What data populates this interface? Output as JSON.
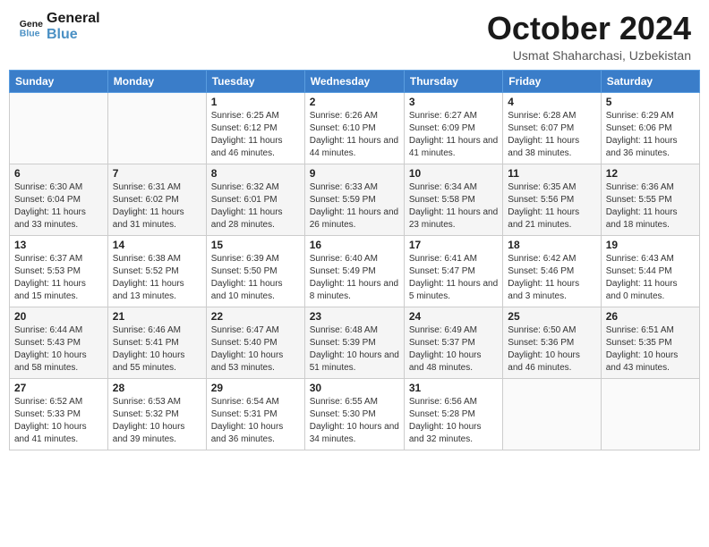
{
  "header": {
    "logo_line1": "General",
    "logo_line2": "Blue",
    "month_title": "October 2024",
    "subtitle": "Usmat Shaharchasi, Uzbekistan"
  },
  "days_of_week": [
    "Sunday",
    "Monday",
    "Tuesday",
    "Wednesday",
    "Thursday",
    "Friday",
    "Saturday"
  ],
  "weeks": [
    [
      {
        "day": "",
        "sunrise": "",
        "sunset": "",
        "daylight": ""
      },
      {
        "day": "",
        "sunrise": "",
        "sunset": "",
        "daylight": ""
      },
      {
        "day": "1",
        "sunrise": "Sunrise: 6:25 AM",
        "sunset": "Sunset: 6:12 PM",
        "daylight": "Daylight: 11 hours and 46 minutes."
      },
      {
        "day": "2",
        "sunrise": "Sunrise: 6:26 AM",
        "sunset": "Sunset: 6:10 PM",
        "daylight": "Daylight: 11 hours and 44 minutes."
      },
      {
        "day": "3",
        "sunrise": "Sunrise: 6:27 AM",
        "sunset": "Sunset: 6:09 PM",
        "daylight": "Daylight: 11 hours and 41 minutes."
      },
      {
        "day": "4",
        "sunrise": "Sunrise: 6:28 AM",
        "sunset": "Sunset: 6:07 PM",
        "daylight": "Daylight: 11 hours and 38 minutes."
      },
      {
        "day": "5",
        "sunrise": "Sunrise: 6:29 AM",
        "sunset": "Sunset: 6:06 PM",
        "daylight": "Daylight: 11 hours and 36 minutes."
      }
    ],
    [
      {
        "day": "6",
        "sunrise": "Sunrise: 6:30 AM",
        "sunset": "Sunset: 6:04 PM",
        "daylight": "Daylight: 11 hours and 33 minutes."
      },
      {
        "day": "7",
        "sunrise": "Sunrise: 6:31 AM",
        "sunset": "Sunset: 6:02 PM",
        "daylight": "Daylight: 11 hours and 31 minutes."
      },
      {
        "day": "8",
        "sunrise": "Sunrise: 6:32 AM",
        "sunset": "Sunset: 6:01 PM",
        "daylight": "Daylight: 11 hours and 28 minutes."
      },
      {
        "day": "9",
        "sunrise": "Sunrise: 6:33 AM",
        "sunset": "Sunset: 5:59 PM",
        "daylight": "Daylight: 11 hours and 26 minutes."
      },
      {
        "day": "10",
        "sunrise": "Sunrise: 6:34 AM",
        "sunset": "Sunset: 5:58 PM",
        "daylight": "Daylight: 11 hours and 23 minutes."
      },
      {
        "day": "11",
        "sunrise": "Sunrise: 6:35 AM",
        "sunset": "Sunset: 5:56 PM",
        "daylight": "Daylight: 11 hours and 21 minutes."
      },
      {
        "day": "12",
        "sunrise": "Sunrise: 6:36 AM",
        "sunset": "Sunset: 5:55 PM",
        "daylight": "Daylight: 11 hours and 18 minutes."
      }
    ],
    [
      {
        "day": "13",
        "sunrise": "Sunrise: 6:37 AM",
        "sunset": "Sunset: 5:53 PM",
        "daylight": "Daylight: 11 hours and 15 minutes."
      },
      {
        "day": "14",
        "sunrise": "Sunrise: 6:38 AM",
        "sunset": "Sunset: 5:52 PM",
        "daylight": "Daylight: 11 hours and 13 minutes."
      },
      {
        "day": "15",
        "sunrise": "Sunrise: 6:39 AM",
        "sunset": "Sunset: 5:50 PM",
        "daylight": "Daylight: 11 hours and 10 minutes."
      },
      {
        "day": "16",
        "sunrise": "Sunrise: 6:40 AM",
        "sunset": "Sunset: 5:49 PM",
        "daylight": "Daylight: 11 hours and 8 minutes."
      },
      {
        "day": "17",
        "sunrise": "Sunrise: 6:41 AM",
        "sunset": "Sunset: 5:47 PM",
        "daylight": "Daylight: 11 hours and 5 minutes."
      },
      {
        "day": "18",
        "sunrise": "Sunrise: 6:42 AM",
        "sunset": "Sunset: 5:46 PM",
        "daylight": "Daylight: 11 hours and 3 minutes."
      },
      {
        "day": "19",
        "sunrise": "Sunrise: 6:43 AM",
        "sunset": "Sunset: 5:44 PM",
        "daylight": "Daylight: 11 hours and 0 minutes."
      }
    ],
    [
      {
        "day": "20",
        "sunrise": "Sunrise: 6:44 AM",
        "sunset": "Sunset: 5:43 PM",
        "daylight": "Daylight: 10 hours and 58 minutes."
      },
      {
        "day": "21",
        "sunrise": "Sunrise: 6:46 AM",
        "sunset": "Sunset: 5:41 PM",
        "daylight": "Daylight: 10 hours and 55 minutes."
      },
      {
        "day": "22",
        "sunrise": "Sunrise: 6:47 AM",
        "sunset": "Sunset: 5:40 PM",
        "daylight": "Daylight: 10 hours and 53 minutes."
      },
      {
        "day": "23",
        "sunrise": "Sunrise: 6:48 AM",
        "sunset": "Sunset: 5:39 PM",
        "daylight": "Daylight: 10 hours and 51 minutes."
      },
      {
        "day": "24",
        "sunrise": "Sunrise: 6:49 AM",
        "sunset": "Sunset: 5:37 PM",
        "daylight": "Daylight: 10 hours and 48 minutes."
      },
      {
        "day": "25",
        "sunrise": "Sunrise: 6:50 AM",
        "sunset": "Sunset: 5:36 PM",
        "daylight": "Daylight: 10 hours and 46 minutes."
      },
      {
        "day": "26",
        "sunrise": "Sunrise: 6:51 AM",
        "sunset": "Sunset: 5:35 PM",
        "daylight": "Daylight: 10 hours and 43 minutes."
      }
    ],
    [
      {
        "day": "27",
        "sunrise": "Sunrise: 6:52 AM",
        "sunset": "Sunset: 5:33 PM",
        "daylight": "Daylight: 10 hours and 41 minutes."
      },
      {
        "day": "28",
        "sunrise": "Sunrise: 6:53 AM",
        "sunset": "Sunset: 5:32 PM",
        "daylight": "Daylight: 10 hours and 39 minutes."
      },
      {
        "day": "29",
        "sunrise": "Sunrise: 6:54 AM",
        "sunset": "Sunset: 5:31 PM",
        "daylight": "Daylight: 10 hours and 36 minutes."
      },
      {
        "day": "30",
        "sunrise": "Sunrise: 6:55 AM",
        "sunset": "Sunset: 5:30 PM",
        "daylight": "Daylight: 10 hours and 34 minutes."
      },
      {
        "day": "31",
        "sunrise": "Sunrise: 6:56 AM",
        "sunset": "Sunset: 5:28 PM",
        "daylight": "Daylight: 10 hours and 32 minutes."
      },
      {
        "day": "",
        "sunrise": "",
        "sunset": "",
        "daylight": ""
      },
      {
        "day": "",
        "sunrise": "",
        "sunset": "",
        "daylight": ""
      }
    ]
  ]
}
